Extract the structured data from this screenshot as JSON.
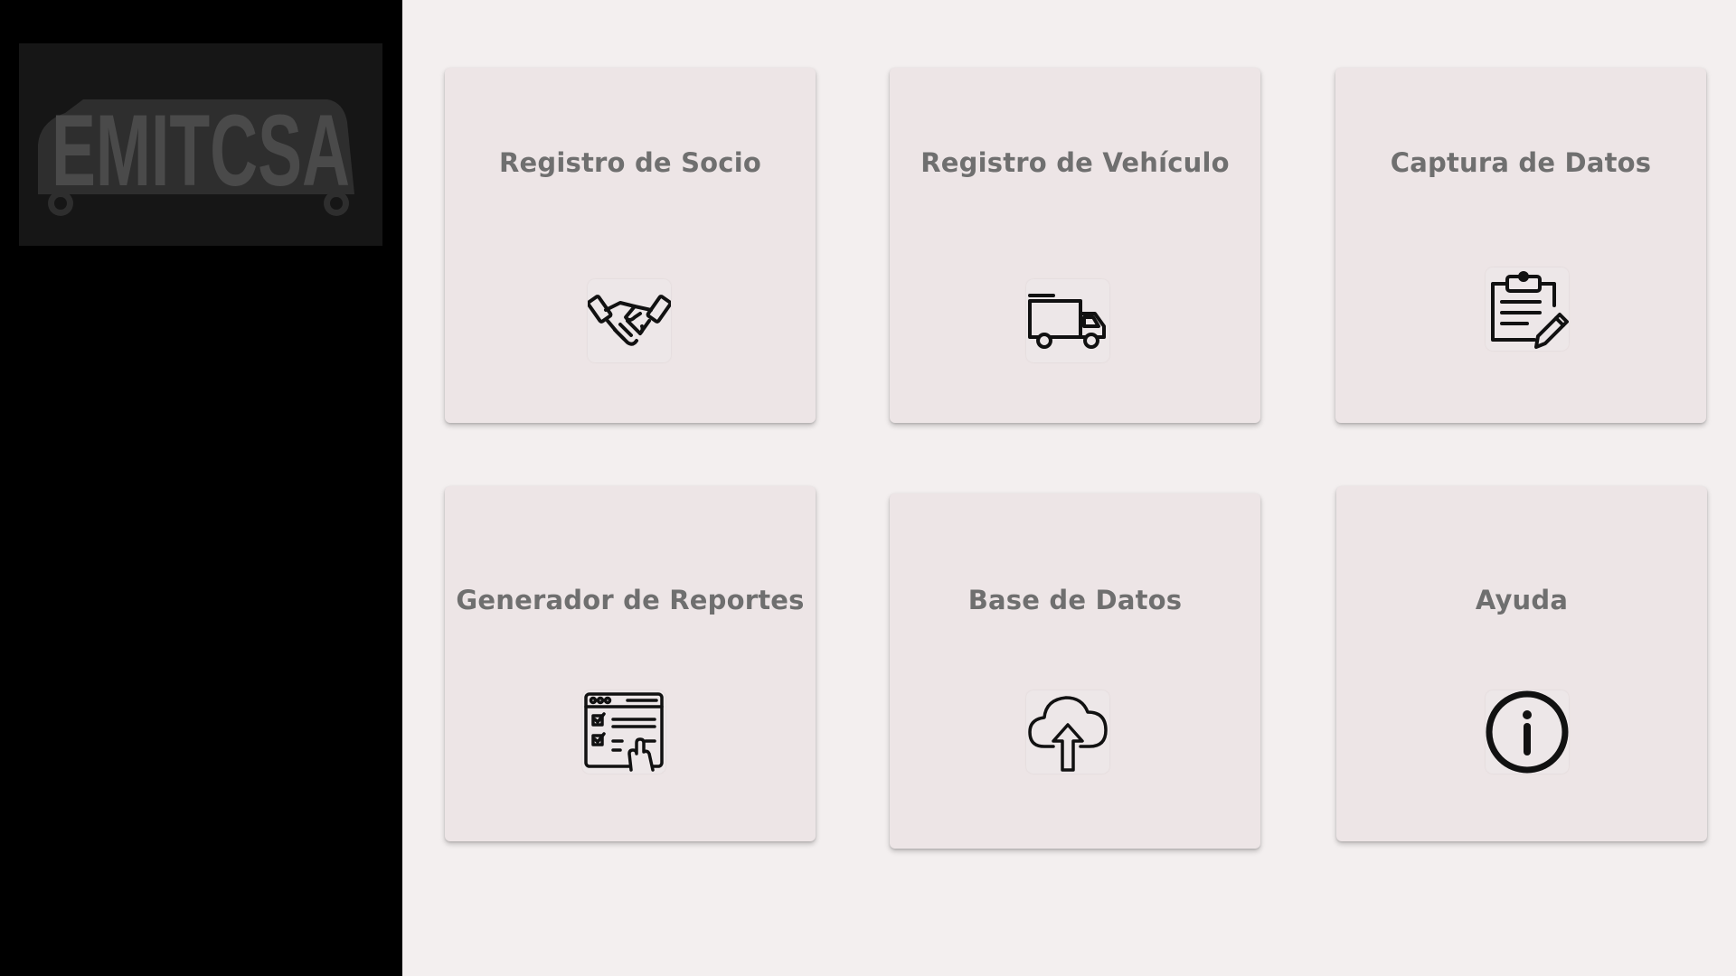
{
  "app": {
    "logo_text": "EMITCSA"
  },
  "colors": {
    "sidebar_bg": "#000000",
    "logo_bg": "#161616",
    "logo_fg": "#4a4a4a",
    "main_bg": "#f3efef",
    "card_bg": "#ede5e6",
    "title_text": "#6f6f6f",
    "icon_stroke": "#111111"
  },
  "cards": [
    {
      "label": "Registro de Socio",
      "icon": "handshake-icon"
    },
    {
      "label": "Registro de Vehículo",
      "icon": "truck-icon"
    },
    {
      "label": "Captura de Datos",
      "icon": "clipboard-edit-icon"
    },
    {
      "label": "Generador de Reportes",
      "icon": "report-checklist-icon"
    },
    {
      "label": "Base de Datos",
      "icon": "cloud-upload-icon"
    },
    {
      "label": "Ayuda",
      "icon": "info-icon"
    }
  ]
}
